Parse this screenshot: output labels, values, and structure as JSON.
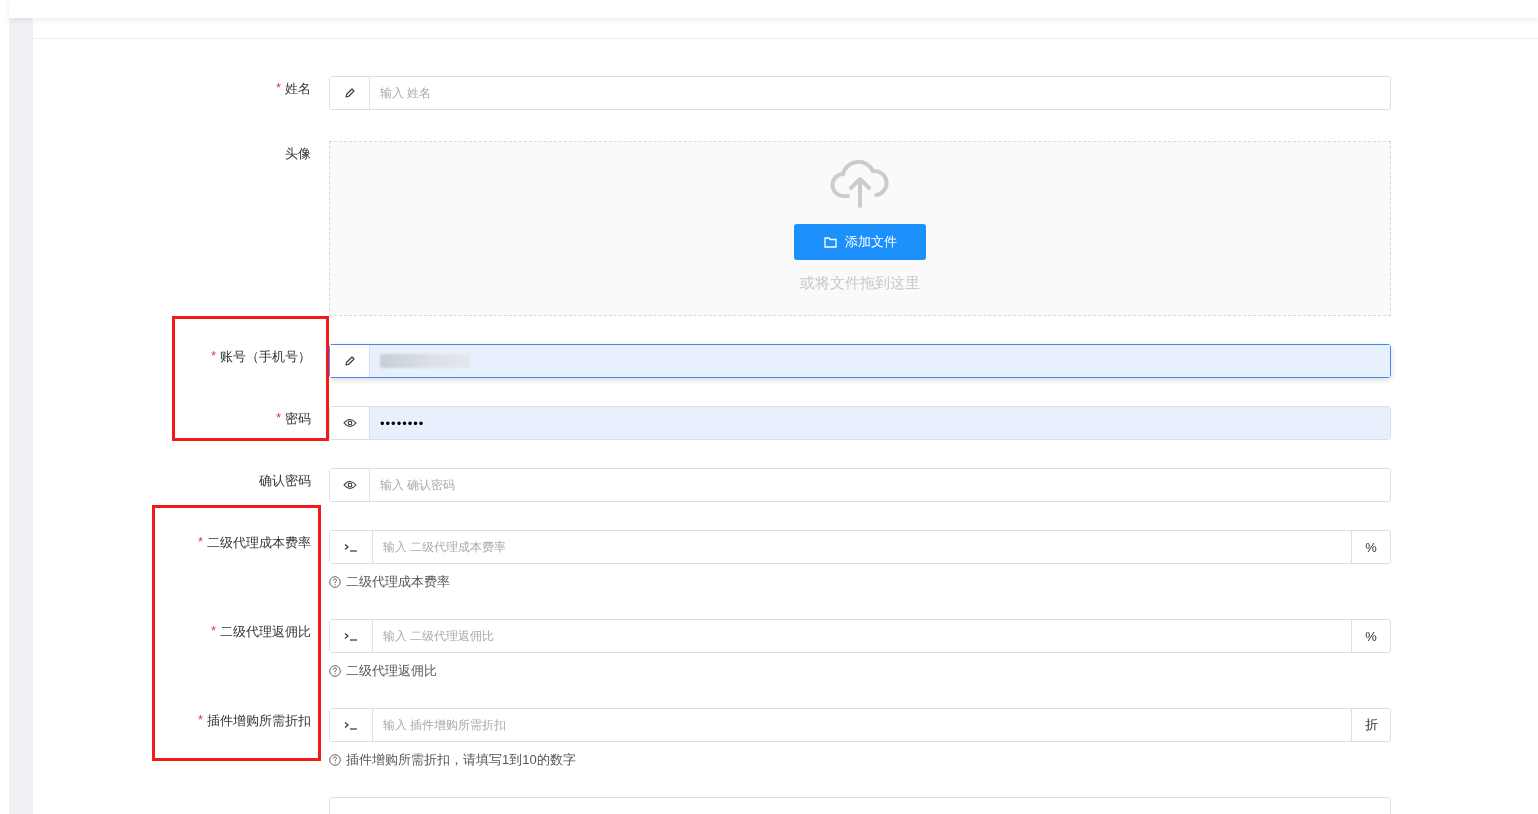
{
  "form": {
    "fields": [
      {
        "kind": "text",
        "label": "姓名",
        "required_mark": "*",
        "placeholder": "输入 姓名",
        "focused": false,
        "autofilled": false
      },
      {
        "kind": "upload",
        "label": "头像",
        "button": "添加文件",
        "hint": "或将文件拖到这里"
      },
      {
        "kind": "text",
        "label": "账号（手机号）",
        "required_mark": "*",
        "value_redacted": true,
        "focused": true,
        "autofilled": true
      },
      {
        "kind": "password",
        "label": "密码",
        "required_mark": "*",
        "value": "••••••••",
        "focused": false,
        "autofilled": true
      },
      {
        "kind": "password",
        "label": "确认密码",
        "placeholder": "输入 确认密码",
        "focused": false,
        "autofilled": false
      },
      {
        "kind": "addon",
        "label": "二级代理成本费率",
        "required_mark": "*",
        "placeholder": "输入 二级代理成本费率",
        "suffix": "%",
        "help": "二级代理成本费率"
      },
      {
        "kind": "addon",
        "label": "二级代理返佣比",
        "required_mark": "*",
        "placeholder": "输入 二级代理返佣比",
        "suffix": "%",
        "help": "二级代理返佣比"
      },
      {
        "kind": "addon",
        "label": "插件增购所需折扣",
        "required_mark": "*",
        "placeholder": "输入 插件增购所需折扣",
        "suffix": "折",
        "help": "插件增购所需折扣，请填写1到10的数字"
      }
    ]
  }
}
